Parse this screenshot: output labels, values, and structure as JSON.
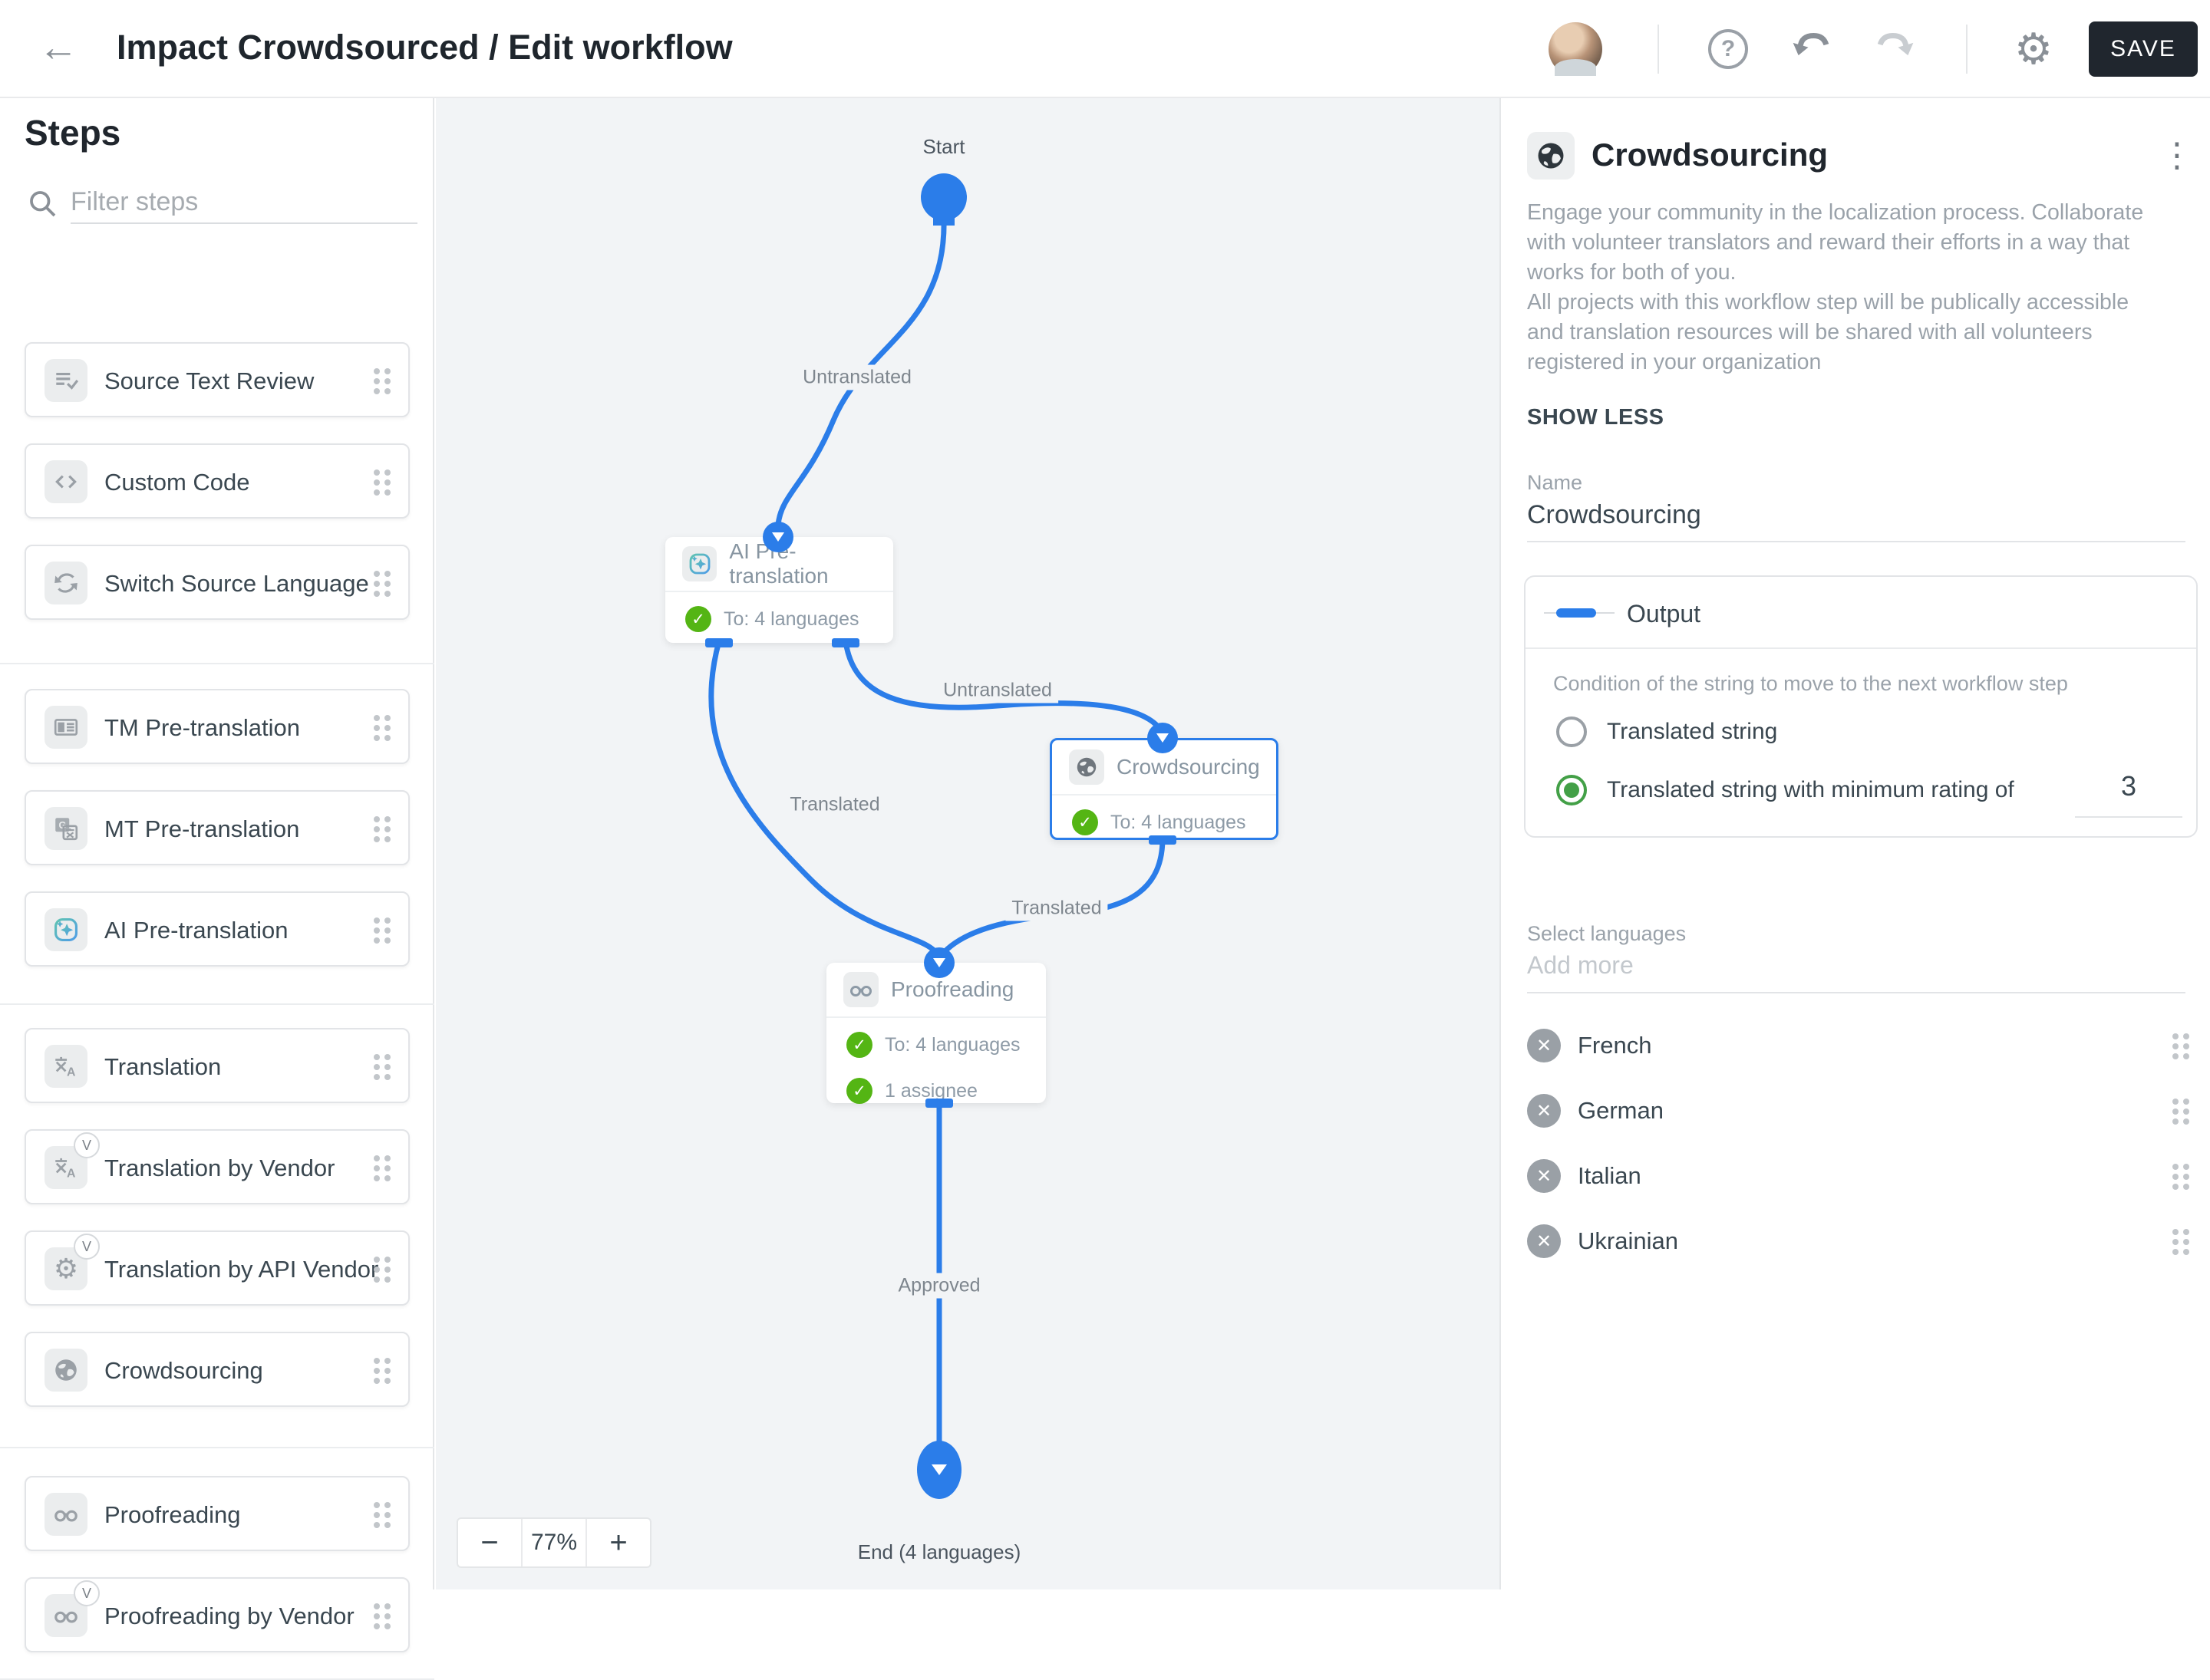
{
  "header": {
    "title": "Impact Crowdsourced / Edit workflow",
    "back_icon": "←",
    "save_label": "SAVE"
  },
  "sidebar": {
    "title": "Steps",
    "filter_placeholder": "Filter steps",
    "groups": [
      {
        "items": [
          {
            "label": "Source Text Review",
            "icon": "source-text-review-icon"
          },
          {
            "label": "Custom Code",
            "icon": "code-icon"
          },
          {
            "label": "Switch Source Language",
            "icon": "switch-arrows-icon"
          }
        ]
      },
      {
        "items": [
          {
            "label": "TM Pre-translation",
            "icon": "translation-memory-icon"
          },
          {
            "label": "MT Pre-translation",
            "icon": "machine-translation-icon"
          },
          {
            "label": "AI Pre-translation",
            "icon": "ai-sparkle-icon"
          }
        ]
      },
      {
        "items": [
          {
            "label": "Translation",
            "icon": "translate-icon"
          },
          {
            "label": "Translation by Vendor",
            "icon": "translate-icon",
            "badge": "V"
          },
          {
            "label": "Translation by API Vendor",
            "icon": "gear-icon",
            "badge": "V"
          },
          {
            "label": "Crowdsourcing",
            "icon": "globe-icon"
          }
        ]
      },
      {
        "items": [
          {
            "label": "Proofreading",
            "icon": "glasses-icon"
          },
          {
            "label": "Proofreading by Vendor",
            "icon": "glasses-icon",
            "badge": "V"
          }
        ]
      }
    ]
  },
  "canvas": {
    "zoom_level": "77%",
    "zoom_out_label": "−",
    "zoom_in_label": "+",
    "nodes": {
      "start": {
        "label": "Start"
      },
      "ai": {
        "title": "AI Pre-translation",
        "rows": [
          "To: 4 languages"
        ]
      },
      "crowdsourcing": {
        "title": "Crowdsourcing",
        "rows": [
          "To: 4 languages"
        ],
        "selected": true
      },
      "proofreading": {
        "title": "Proofreading",
        "rows": [
          "To: 4 languages",
          "1 assignee"
        ]
      },
      "end": {
        "label": "End (4 languages)"
      }
    },
    "edges": [
      {
        "label": "Untranslated",
        "from": "start",
        "to": "ai"
      },
      {
        "label": "Translated",
        "from": "ai",
        "to": "proofreading"
      },
      {
        "label": "Untranslated",
        "from": "ai",
        "to": "crowdsourcing"
      },
      {
        "label": "Translated",
        "from": "crowdsourcing",
        "to": "proofreading"
      },
      {
        "label": "Approved",
        "from": "proofreading",
        "to": "end"
      }
    ]
  },
  "panel": {
    "title": "Crowdsourcing",
    "icon": "globe-icon",
    "description": "Engage your community in the localization process. Collaborate with volunteer translators and reward their efforts in a way that works for both of you.\nAll projects with this workflow step will be publically accessible and translation resources will be shared with all volunteers registered in your organization",
    "show_less_label": "SHOW LESS",
    "name_label": "Name",
    "name_value": "Crowdsourcing",
    "output": {
      "title": "Output",
      "condition_label": "Condition of the string to move to the next workflow step",
      "options": [
        {
          "label": "Translated string",
          "selected": false
        },
        {
          "label": "Translated string with minimum rating of",
          "selected": true
        }
      ],
      "rating_value": "3"
    },
    "languages": {
      "label": "Select languages",
      "placeholder": "Add more",
      "items": [
        "French",
        "German",
        "Italian",
        "Ukrainian"
      ]
    }
  },
  "colors": {
    "accent_blue": "#2b7de9",
    "check_green": "#54b514",
    "radio_green": "#43a047",
    "canvas_bg": "#f2f4f6",
    "save_button_bg": "#20262e"
  }
}
